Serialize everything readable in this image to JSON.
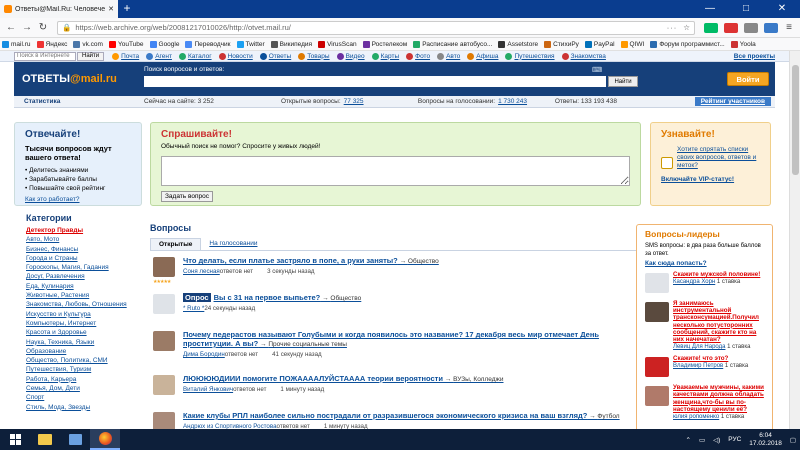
{
  "browser": {
    "tab_title": "Ответы@Mail.Ru: Человечес...",
    "url": "https://web.archive.org/web/20081217010026/http://otvet.mail.ru/",
    "window_buttons": [
      "—",
      "□",
      "✕"
    ]
  },
  "bookmarks": [
    "mail.ru",
    "Яндекс",
    "vk.com",
    "YouTube",
    "Google",
    "Переводчик",
    "Twitter",
    "Википедия",
    "VirusScan",
    "Ростелеком",
    "Расписание автобусо...",
    "Assetstore",
    "СтихиРу",
    "PayPal",
    "QIWI",
    "Форум программист...",
    "Yoola"
  ],
  "projects": {
    "search_placeholder": "Поиск в Интернете",
    "search_button": "Найти",
    "links": [
      "Почта",
      "Агент",
      "Каталог",
      "Новости",
      "Ответы",
      "Товары",
      "Видео",
      "Карты",
      "Фото",
      "Авто",
      "Афиша",
      "Путешествия",
      "Знакомства"
    ],
    "all_projects": "Все проекты"
  },
  "header": {
    "logo_main": "ОТВЕТЫ",
    "logo_accent": "@mail.ru",
    "search_label": "Поиск вопросов и ответов:",
    "find_button": "Найти",
    "ask_button": "Войти"
  },
  "statbar": {
    "title": "Статистика",
    "on_site": "Сейчас на сайте: 3 252",
    "open_label": "Открытые вопросы:",
    "open_value": "77 325",
    "voting_label": "Вопросы на голосовании:",
    "voting_value": "1 730 243",
    "answers": "Ответы: 133 193 438",
    "rating": "Рейтинг участников"
  },
  "answer_box": {
    "title": "Отвечайте!",
    "lead": "Тысячи вопросов ждут вашего ответа!",
    "items": [
      "Делитесь знаниями",
      "Зарабатывайте баллы",
      "Повышайте свой рейтинг"
    ],
    "how": "Как это работает?"
  },
  "ask_box": {
    "title": "Спрашивайте!",
    "subtitle": "Обычный поиск не помог? Спросите у живых людей!",
    "button": "Задать вопрос"
  },
  "learn_box": {
    "title": "Узнавайте!",
    "link1": "Хотите спрятать списки своих вопросов, ответов и меток?",
    "link2": "Включайте VIP-статус!"
  },
  "categories": {
    "title": "Категории",
    "items": [
      "Детектор Правды",
      "Авто, Мото",
      "Бизнес, Финансы",
      "Города и Страны",
      "Гороскопы, Магия, Гадания",
      "Досуг, Развлечения",
      "Еда, Кулинария",
      "Животные, Растения",
      "Знакомства, Любовь, Отношения",
      "Искусство и Культура",
      "Компьютеры, Интернет",
      "Красота и Здоровье",
      "Наука, Техника, Языки",
      "Образование",
      "Общество, Политика, СМИ",
      "Путешествия, Туризм",
      "Работа, Карьера",
      "Семья, Дом, Дети",
      "Спорт",
      "Стиль, Мода, Звезды"
    ]
  },
  "questions": {
    "title": "Вопросы",
    "tabs": [
      "Открытые",
      "На голосовании"
    ],
    "items": [
      {
        "title": "Что делать, если платье застряло в попе, а руки заняты?",
        "cat": "Общество",
        "user": "Соня лесная",
        "answers": "ответов нет",
        "time": "3 секунды назад",
        "opros": ""
      },
      {
        "title": "Вы с 31 на первое выпьете?",
        "cat": "Общество",
        "user": "* Ruto *",
        "answers": "",
        "time": "24 секунды назад",
        "opros": "Опрос"
      },
      {
        "title": "Почему педерастов называют Голубыми и когда появилось это название? 17 декабря весь мир отмечает День проституции. А вы?",
        "cat": "Прочие социальные темы",
        "user": "Дима Бородин",
        "answers": "ответов нет",
        "time": "41 секунду назад",
        "opros": ""
      },
      {
        "title": "ЛЮЮЮЮДИИИ помогите ПОЖААААЛУЙСТАААА теории вероятности",
        "cat": "ВУЗы, Колледжи",
        "user": "Виталий Янкович",
        "answers": "ответов нет",
        "time": "1 минуту назад",
        "opros": ""
      },
      {
        "title": "Какие клубы РПЛ наиболее сильно пострадали от разразившегося экономического кризиса на ваш взгляд?",
        "cat": "Футбол",
        "user": "Андрюх из Спортивного Ростова",
        "answers": "ответов нет",
        "time": "1 минуту назад",
        "opros": ""
      }
    ]
  },
  "leaders": {
    "title": "Вопросы-лидеры",
    "sms": "SMS вопросы: в два раза больше баллов за ответ.",
    "how": "Как сюда попасть?",
    "items": [
      {
        "title": "Скажите мужской половине!",
        "user": "Касандра Хорн",
        "votes": "1 ставка"
      },
      {
        "title": "Я занимаюсь инструментальной трансконсумацией.Получил несколько потусторонних сообщений, скажите кто на них начечатан?",
        "user": "Левиц Для Народа",
        "votes": "1 ставка"
      },
      {
        "title": "Скажите! что это?",
        "user": "Владимир Петров",
        "votes": "1 ставка"
      },
      {
        "title": "Уважаемые мужчины, какими качествами должна обладать женщина,что-бы вы по-настоящему ценили её?",
        "user": "юлия ропоменко",
        "votes": "1 ставка"
      }
    ]
  },
  "taskbar": {
    "lang": "РУС",
    "time": "6:04",
    "date": "17.02.2018"
  }
}
